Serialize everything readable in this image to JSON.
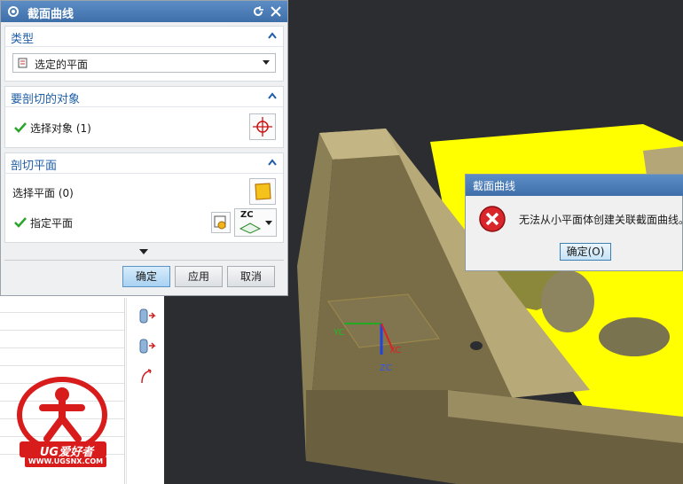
{
  "dialog": {
    "title": "截面曲线",
    "sections": {
      "type": {
        "header": "类型",
        "dropdown_value": "选定的平面"
      },
      "objects": {
        "header": "要剖切的对象",
        "select_label": "选择对象 (1)"
      },
      "plane": {
        "header": "剖切平面",
        "select_label": "选择平面 (0)",
        "specify_label": "指定平面",
        "plane_dropdown_icon": "ZC"
      }
    },
    "buttons": {
      "ok": "确定",
      "apply": "应用",
      "cancel": "取消"
    }
  },
  "message_box": {
    "title": "截面曲线",
    "text": "无法从小平面体创建关联截面曲线。",
    "ok_label": "确定(O)"
  },
  "viewport": {
    "axis_labels": {
      "x": "XC",
      "y": "YC",
      "z": "ZC"
    },
    "colors": {
      "part": "#a89a6c",
      "highlight": "#ffff00",
      "background": "#2b2d31"
    }
  },
  "watermark": {
    "brand": "UG爱好者",
    "url": "WWW.UGSNX.COM"
  },
  "icons": [
    "gear-icon",
    "reset-icon",
    "close-icon",
    "collapse-icon",
    "crosshair-icon",
    "plane-icon",
    "check-icon",
    "error-icon"
  ]
}
